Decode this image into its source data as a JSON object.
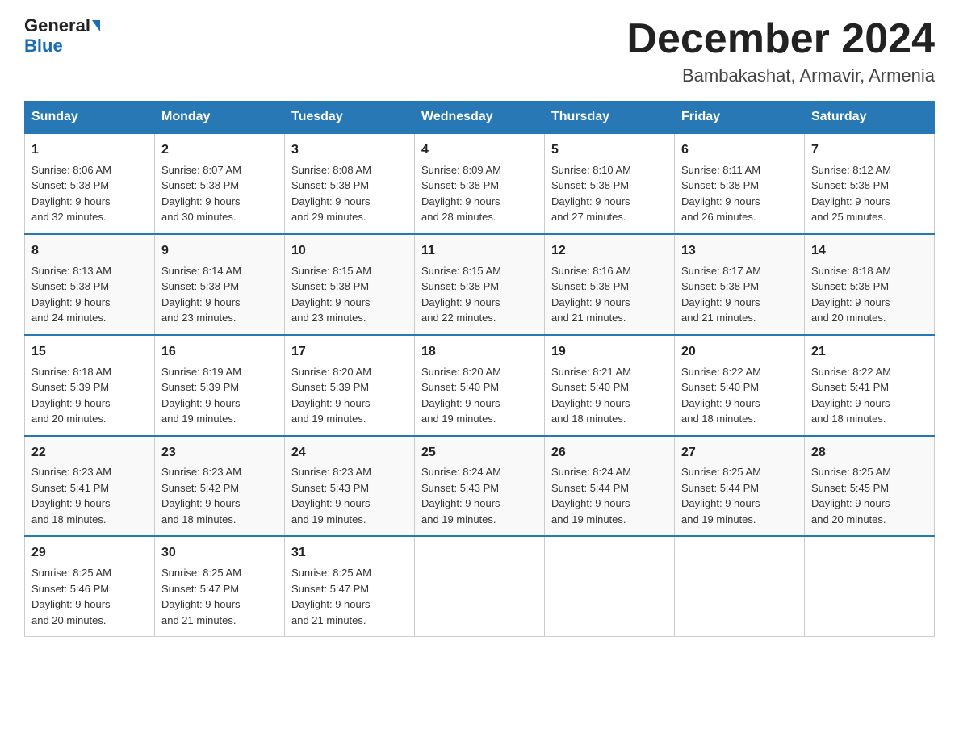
{
  "header": {
    "logo_general": "General",
    "logo_blue": "Blue",
    "month_title": "December 2024",
    "location": "Bambakashat, Armavir, Armenia"
  },
  "days_of_week": [
    "Sunday",
    "Monday",
    "Tuesday",
    "Wednesday",
    "Thursday",
    "Friday",
    "Saturday"
  ],
  "weeks": [
    [
      {
        "day": "1",
        "sunrise": "8:06 AM",
        "sunset": "5:38 PM",
        "daylight": "9 hours and 32 minutes."
      },
      {
        "day": "2",
        "sunrise": "8:07 AM",
        "sunset": "5:38 PM",
        "daylight": "9 hours and 30 minutes."
      },
      {
        "day": "3",
        "sunrise": "8:08 AM",
        "sunset": "5:38 PM",
        "daylight": "9 hours and 29 minutes."
      },
      {
        "day": "4",
        "sunrise": "8:09 AM",
        "sunset": "5:38 PM",
        "daylight": "9 hours and 28 minutes."
      },
      {
        "day": "5",
        "sunrise": "8:10 AM",
        "sunset": "5:38 PM",
        "daylight": "9 hours and 27 minutes."
      },
      {
        "day": "6",
        "sunrise": "8:11 AM",
        "sunset": "5:38 PM",
        "daylight": "9 hours and 26 minutes."
      },
      {
        "day": "7",
        "sunrise": "8:12 AM",
        "sunset": "5:38 PM",
        "daylight": "9 hours and 25 minutes."
      }
    ],
    [
      {
        "day": "8",
        "sunrise": "8:13 AM",
        "sunset": "5:38 PM",
        "daylight": "9 hours and 24 minutes."
      },
      {
        "day": "9",
        "sunrise": "8:14 AM",
        "sunset": "5:38 PM",
        "daylight": "9 hours and 23 minutes."
      },
      {
        "day": "10",
        "sunrise": "8:15 AM",
        "sunset": "5:38 PM",
        "daylight": "9 hours and 23 minutes."
      },
      {
        "day": "11",
        "sunrise": "8:15 AM",
        "sunset": "5:38 PM",
        "daylight": "9 hours and 22 minutes."
      },
      {
        "day": "12",
        "sunrise": "8:16 AM",
        "sunset": "5:38 PM",
        "daylight": "9 hours and 21 minutes."
      },
      {
        "day": "13",
        "sunrise": "8:17 AM",
        "sunset": "5:38 PM",
        "daylight": "9 hours and 21 minutes."
      },
      {
        "day": "14",
        "sunrise": "8:18 AM",
        "sunset": "5:38 PM",
        "daylight": "9 hours and 20 minutes."
      }
    ],
    [
      {
        "day": "15",
        "sunrise": "8:18 AM",
        "sunset": "5:39 PM",
        "daylight": "9 hours and 20 minutes."
      },
      {
        "day": "16",
        "sunrise": "8:19 AM",
        "sunset": "5:39 PM",
        "daylight": "9 hours and 19 minutes."
      },
      {
        "day": "17",
        "sunrise": "8:20 AM",
        "sunset": "5:39 PM",
        "daylight": "9 hours and 19 minutes."
      },
      {
        "day": "18",
        "sunrise": "8:20 AM",
        "sunset": "5:40 PM",
        "daylight": "9 hours and 19 minutes."
      },
      {
        "day": "19",
        "sunrise": "8:21 AM",
        "sunset": "5:40 PM",
        "daylight": "9 hours and 18 minutes."
      },
      {
        "day": "20",
        "sunrise": "8:22 AM",
        "sunset": "5:40 PM",
        "daylight": "9 hours and 18 minutes."
      },
      {
        "day": "21",
        "sunrise": "8:22 AM",
        "sunset": "5:41 PM",
        "daylight": "9 hours and 18 minutes."
      }
    ],
    [
      {
        "day": "22",
        "sunrise": "8:23 AM",
        "sunset": "5:41 PM",
        "daylight": "9 hours and 18 minutes."
      },
      {
        "day": "23",
        "sunrise": "8:23 AM",
        "sunset": "5:42 PM",
        "daylight": "9 hours and 18 minutes."
      },
      {
        "day": "24",
        "sunrise": "8:23 AM",
        "sunset": "5:43 PM",
        "daylight": "9 hours and 19 minutes."
      },
      {
        "day": "25",
        "sunrise": "8:24 AM",
        "sunset": "5:43 PM",
        "daylight": "9 hours and 19 minutes."
      },
      {
        "day": "26",
        "sunrise": "8:24 AM",
        "sunset": "5:44 PM",
        "daylight": "9 hours and 19 minutes."
      },
      {
        "day": "27",
        "sunrise": "8:25 AM",
        "sunset": "5:44 PM",
        "daylight": "9 hours and 19 minutes."
      },
      {
        "day": "28",
        "sunrise": "8:25 AM",
        "sunset": "5:45 PM",
        "daylight": "9 hours and 20 minutes."
      }
    ],
    [
      {
        "day": "29",
        "sunrise": "8:25 AM",
        "sunset": "5:46 PM",
        "daylight": "9 hours and 20 minutes."
      },
      {
        "day": "30",
        "sunrise": "8:25 AM",
        "sunset": "5:47 PM",
        "daylight": "9 hours and 21 minutes."
      },
      {
        "day": "31",
        "sunrise": "8:25 AM",
        "sunset": "5:47 PM",
        "daylight": "9 hours and 21 minutes."
      },
      null,
      null,
      null,
      null
    ]
  ],
  "labels": {
    "sunrise": "Sunrise:",
    "sunset": "Sunset:",
    "daylight": "Daylight:"
  }
}
